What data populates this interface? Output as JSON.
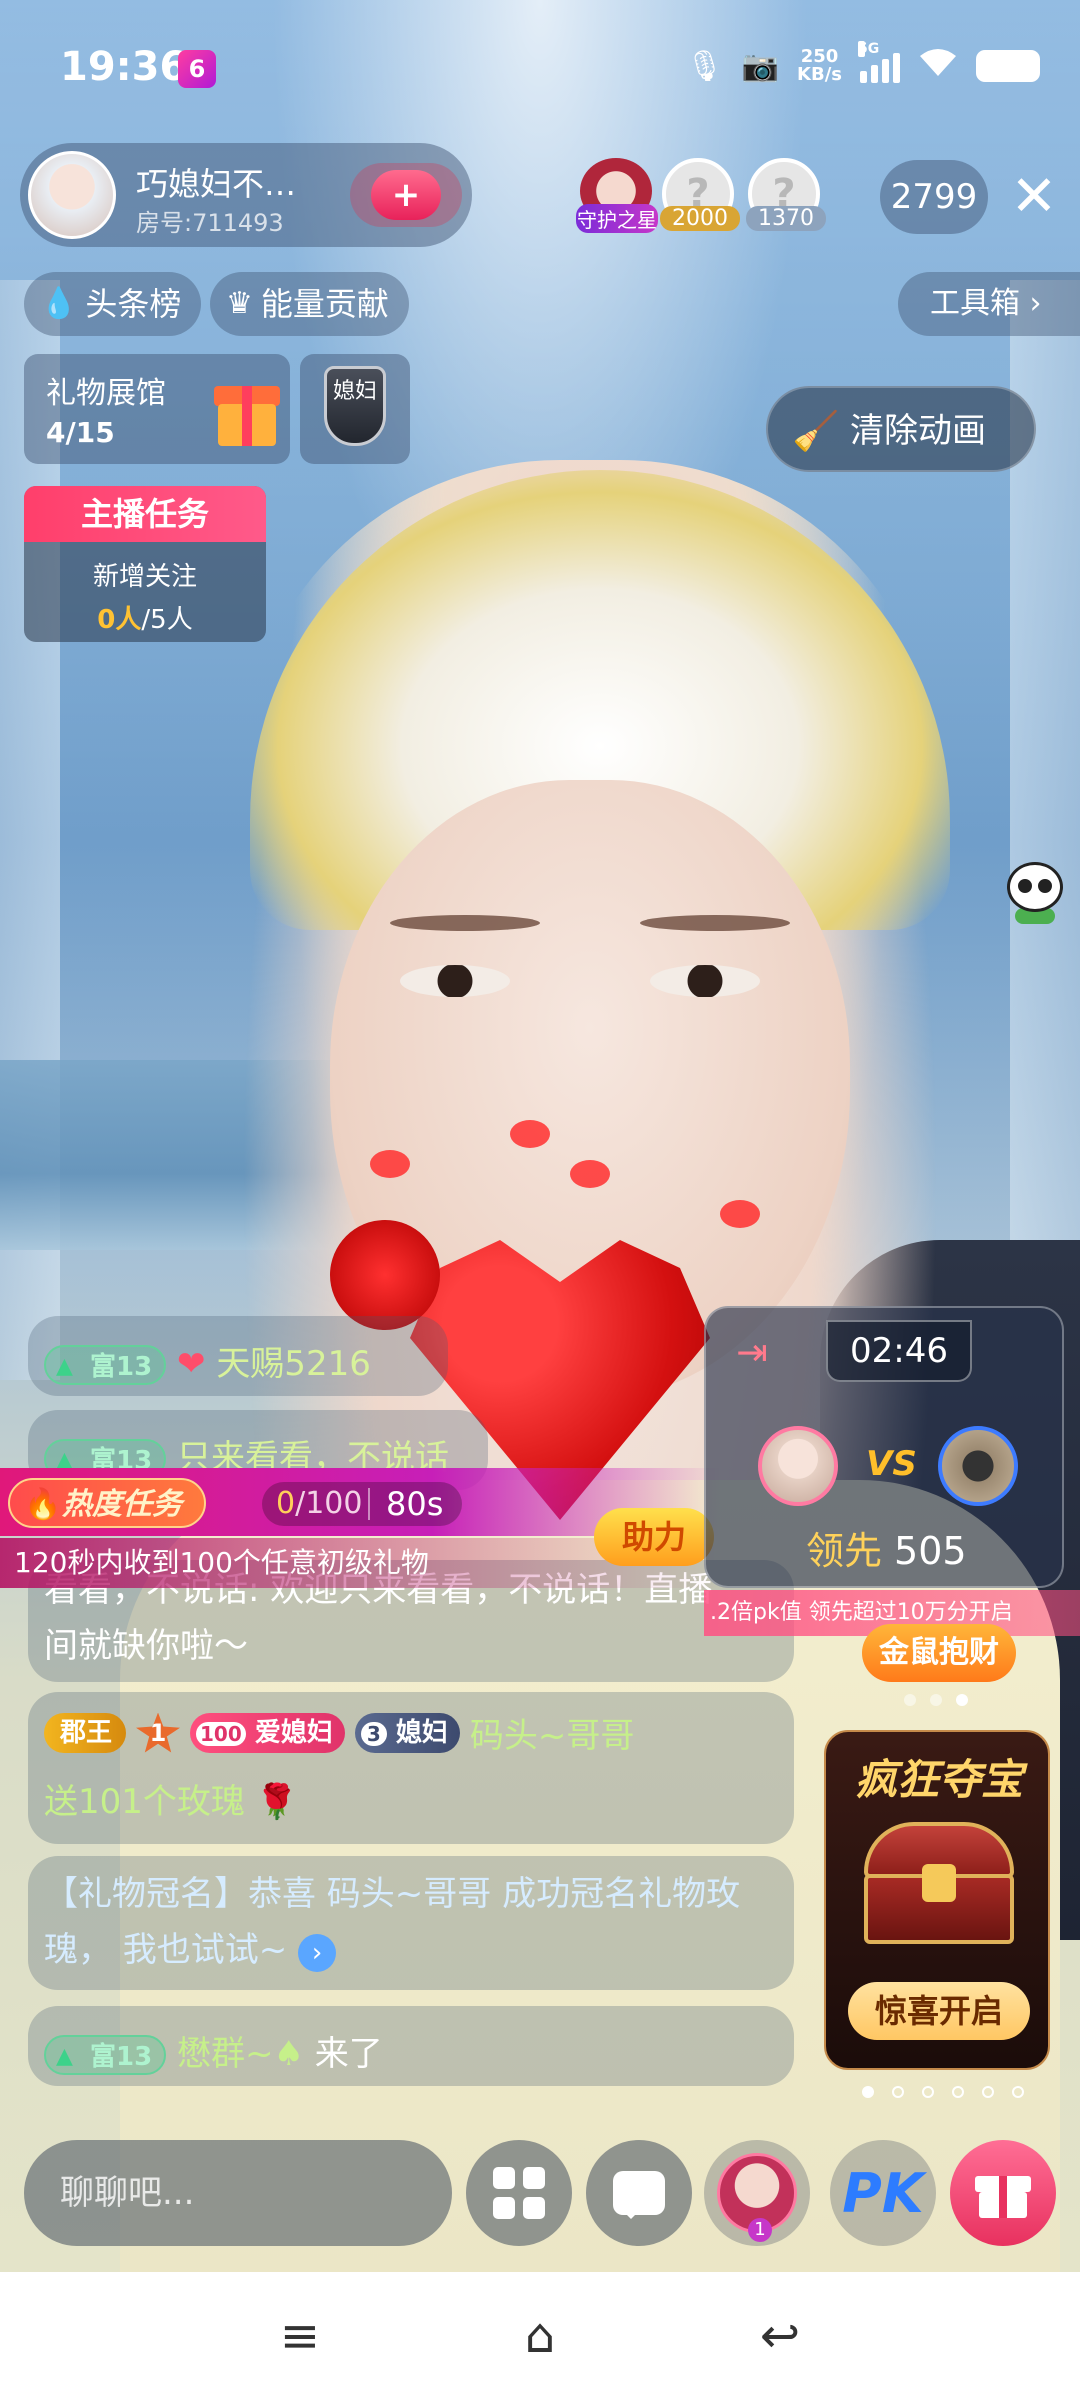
{
  "status_bar": {
    "time": "19:36",
    "app_badge": "6",
    "net_speed_top": "250",
    "net_speed_bottom": "KB/s",
    "network": "5G"
  },
  "header": {
    "host_name": "巧媳妇不…",
    "room_id": "房号:711493",
    "follow_icon": "+",
    "guard_label": "守护之星",
    "viewer_1_points": "2000",
    "viewer_2_points": "1370",
    "viewer_count": "2799",
    "close_icon": "✕"
  },
  "top_chips": {
    "headline_rank": "头条榜",
    "energy": "能量贡献",
    "toolbox": "工具箱 ›"
  },
  "gallery": {
    "title": "礼物展馆",
    "progress": "4/15",
    "badge_text": "媳妇"
  },
  "clear_animation": "清除动画",
  "anchor_task": {
    "title": "主播任务",
    "line1": "新增关注",
    "current": "0人",
    "target": "/5人"
  },
  "chat": {
    "msg1": {
      "level": "富13",
      "text": "天赐5216"
    },
    "msg2": {
      "level": "富13",
      "text": "只来看看，不说话"
    },
    "msg3": {
      "line1": "看看，不说话: 欢迎只来看看，不说话！直播",
      "line2": "间就缺你啦～"
    },
    "msg4": {
      "rank1": "郡王",
      "rank2": "1",
      "rank3": "100",
      "rank3_label": "爱媳妇",
      "rank4": "3",
      "rank4_label": "媳妇",
      "user": "码头~哥哥",
      "text": "送101个玫瑰"
    },
    "msg5": {
      "line1": "【礼物冠名】恭喜 码头~哥哥 成功冠名礼物玫",
      "line2": "瑰，  我也试试~"
    },
    "msg6": {
      "level": "富13",
      "user": "懋群~♠",
      "text": "来了"
    }
  },
  "hot_task": {
    "label": "热度任务",
    "progress_current": "0",
    "progress_target": "/100",
    "seconds": "80s",
    "description": "120秒内收到100个任意初级礼物",
    "assist_button": "助力"
  },
  "pk": {
    "timer": "02:46",
    "vs": "VS",
    "lead_label": "领先",
    "lead_value": "505",
    "info": ".2倍pk值   领先超过10万分开启",
    "gold_mouse": "金鼠抱财"
  },
  "treasure": {
    "title": "疯狂夺宝",
    "button": "惊喜开启"
  },
  "bottom_bar": {
    "chat_placeholder": "聊聊吧...",
    "guard_count": "1",
    "pk_label": "PK"
  },
  "icons": {
    "menu": "≡",
    "home": "⌂",
    "back": "↩"
  }
}
